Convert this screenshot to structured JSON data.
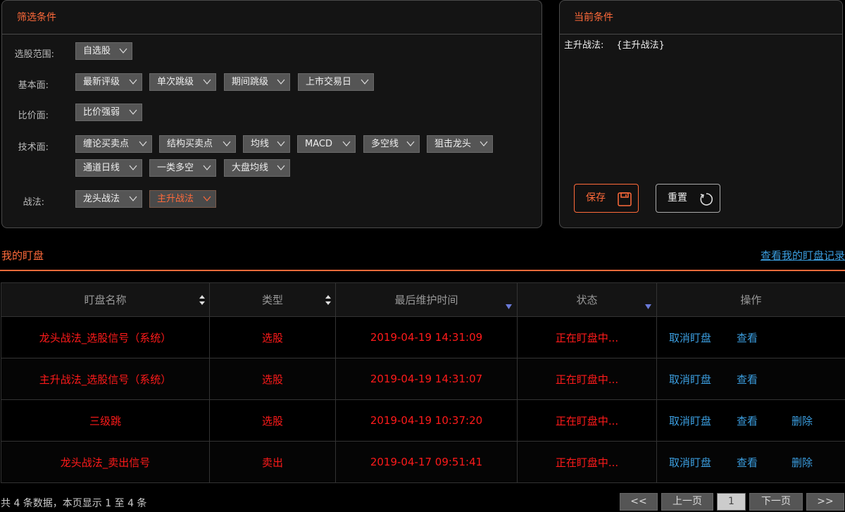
{
  "filter": {
    "title": "筛选条件",
    "rows": [
      {
        "label": "选股范围:",
        "items": [
          "自选股"
        ]
      },
      {
        "label": "基本面:",
        "items": [
          "最新评级",
          "单次跳级",
          "期间跳级",
          "上市交易日"
        ]
      },
      {
        "label": "比价面:",
        "items": [
          "比价强弱"
        ]
      },
      {
        "label": "技术面:",
        "items": [
          "缠论买卖点",
          "结构买卖点",
          "均线",
          "MACD",
          "多空线",
          "狙击龙头",
          "通道日线",
          "一类多空",
          "大盘均线"
        ]
      },
      {
        "label": "战法:",
        "items": [
          "龙头战法",
          "主升战法"
        ]
      }
    ]
  },
  "conditions": {
    "title": "当前条件",
    "key": "主升战法:",
    "value": "{主升战法}",
    "save_label": "保存",
    "reset_label": "重置"
  },
  "watch": {
    "title": "我的盯盘",
    "records_link": "查看我的盯盘记录",
    "headers": [
      "盯盘名称",
      "类型",
      "最后维护时间",
      "状态",
      "操作"
    ],
    "rows": [
      {
        "name": "龙头战法_选股信号（系统）",
        "type": "选股",
        "time": "2019-04-19 14:31:09",
        "status": "正在盯盘中...",
        "ops": [
          "取消盯盘",
          "查看"
        ]
      },
      {
        "name": "主升战法_选股信号（系统）",
        "type": "选股",
        "time": "2019-04-19 14:31:07",
        "status": "正在盯盘中...",
        "ops": [
          "取消盯盘",
          "查看"
        ]
      },
      {
        "name": "三级跳",
        "type": "选股",
        "time": "2019-04-19 10:37:20",
        "status": "正在盯盘中...",
        "ops": [
          "取消盯盘",
          "查看",
          "删除"
        ]
      },
      {
        "name": "龙头战法_卖出信号",
        "type": "卖出",
        "time": "2019-04-17 09:51:41",
        "status": "正在盯盘中...",
        "ops": [
          "取消盯盘",
          "查看",
          "删除"
        ]
      }
    ]
  },
  "pagination": {
    "summary": "共 4 条数据，本页显示 1 至 4 条",
    "first": "<<",
    "prev": "上一页",
    "current": "1",
    "next": "下一页",
    "last": ">>"
  },
  "colors": {
    "accent": "#ff6a3a",
    "link": "#3b9ee0",
    "row_text": "#ff1a1a"
  }
}
